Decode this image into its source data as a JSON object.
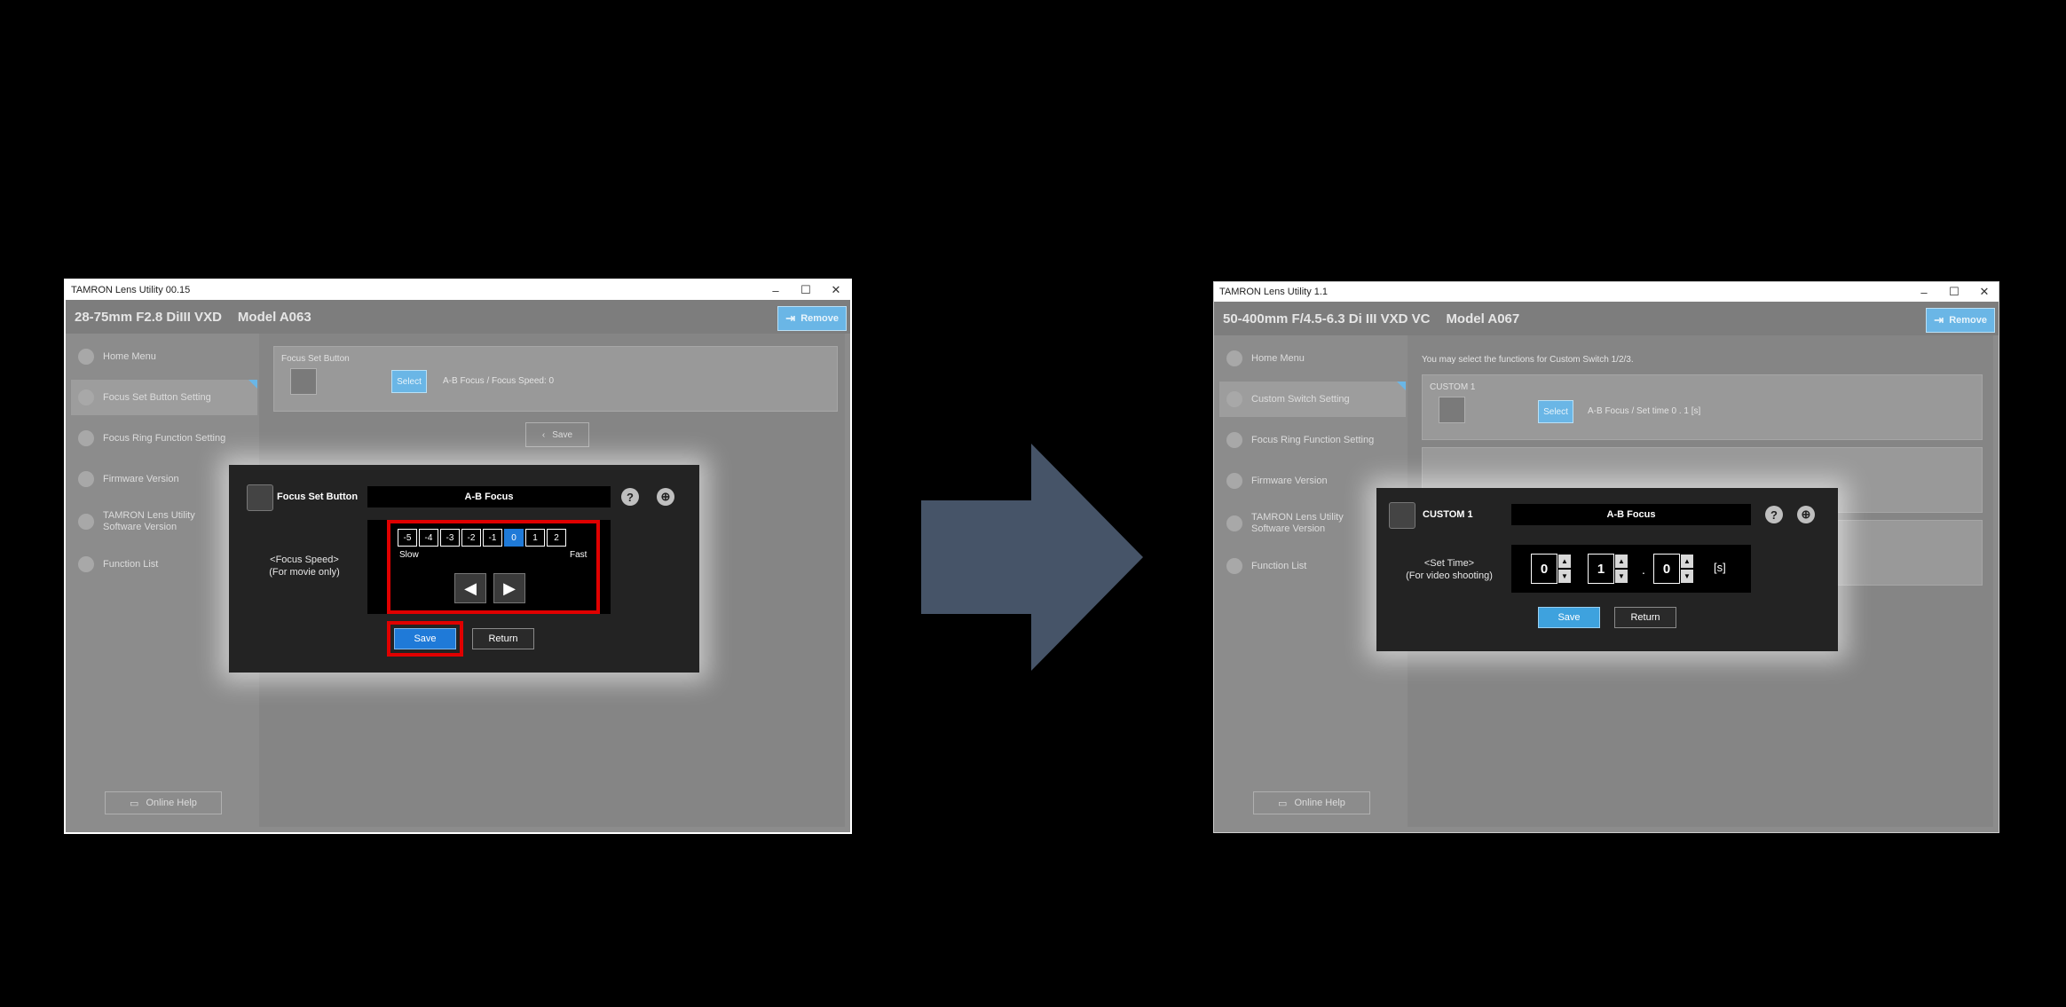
{
  "left": {
    "window_title": "TAMRON Lens Utility  00.15",
    "lens_name": "28-75mm F2.8 DiIII VXD",
    "model": "Model A063",
    "remove_label": "Remove",
    "sidebar": [
      {
        "label": "Home Menu",
        "icon": "home-icon"
      },
      {
        "label": "Focus Set Button Setting",
        "icon": "focus-button-icon"
      },
      {
        "label": "Focus Ring Function Setting",
        "icon": "focus-ring-icon"
      },
      {
        "label": "Firmware Version",
        "icon": "firmware-icon"
      },
      {
        "label": "TAMRON Lens Utility",
        "label2": "Software Version",
        "icon": "info-icon"
      },
      {
        "label": "Function List",
        "icon": "list-icon"
      }
    ],
    "online_help": "Online Help",
    "card": {
      "label": "Focus Set Button",
      "select": "Select",
      "desc": "A-B Focus  / Focus Speed: 0"
    },
    "ghost_save": "Save",
    "dialog": {
      "title": "Focus Set Button",
      "value": "A-B Focus",
      "param_label_1": "<Focus Speed>",
      "param_label_2": "(For movie only)",
      "speeds": [
        "-5",
        "-4",
        "-3",
        "-2",
        "-1",
        "0",
        "1",
        "2"
      ],
      "selected_index": 5,
      "slow": "Slow",
      "fast": "Fast",
      "save": "Save",
      "return": "Return"
    }
  },
  "right": {
    "window_title": "TAMRON Lens Utility 1.1",
    "lens_name": "50-400mm F/4.5-6.3 Di III VXD VC",
    "model": "Model A067",
    "remove_label": "Remove",
    "sidebar": [
      {
        "label": "Home Menu",
        "icon": "home-icon"
      },
      {
        "label": "Custom Switch Setting",
        "icon": "switch-icon"
      },
      {
        "label": "Focus Ring Function Setting",
        "icon": "focus-ring-icon"
      },
      {
        "label": "Firmware Version",
        "icon": "firmware-icon"
      },
      {
        "label": "TAMRON Lens Utility",
        "label2": "Software Version",
        "icon": "info-icon"
      },
      {
        "label": "Function List",
        "icon": "list-icon"
      }
    ],
    "online_help": "Online Help",
    "intro": "You may select the functions for Custom Switch 1/2/3.",
    "card": {
      "label": "CUSTOM 1",
      "select": "Select",
      "desc": "A-B Focus  / Set time 0 . 1 [s]"
    },
    "dialog": {
      "title": "CUSTOM 1",
      "value": "A-B Focus",
      "param_label_1": "<Set Time>",
      "param_label_2": "(For video shooting)",
      "digit1": "0",
      "digit2": "1",
      "digit3": "0",
      "dot": ".",
      "unit": "[s]",
      "save": "Save",
      "return": "Return"
    }
  },
  "colors": {
    "highlight_red": "#e00000",
    "accent_blue": "#1f7ad8",
    "arrow": "#465468"
  }
}
